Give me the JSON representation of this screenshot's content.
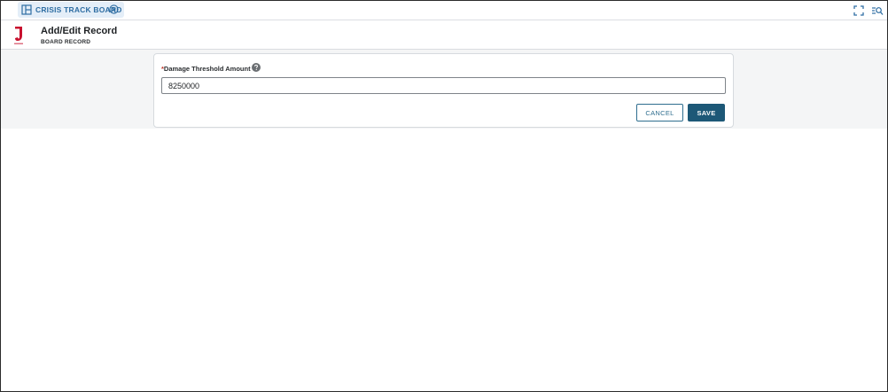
{
  "tab": {
    "label": "CRISIS TRACK BOARD",
    "icon": "board-layout-icon",
    "close_icon": "close-circle-icon"
  },
  "toolbar": {
    "fullscreen_icon": "fullscreen-icon",
    "search_list_icon": "search-list-icon"
  },
  "header": {
    "title": "Add/Edit Record",
    "subtitle": "BOARD RECORD",
    "logo": "juvare-logo"
  },
  "form": {
    "required_mark": "*",
    "field_label": "Damage Threshold Amount",
    "help_icon": "question-circle-icon",
    "field_value": "8250000"
  },
  "buttons": {
    "cancel_label": "CANCEL",
    "save_label": "SAVE"
  },
  "colors": {
    "accent": "#1d5877",
    "tab_text": "#2f6ea3",
    "required": "#c0392b",
    "logo_red": "#c8102e"
  }
}
